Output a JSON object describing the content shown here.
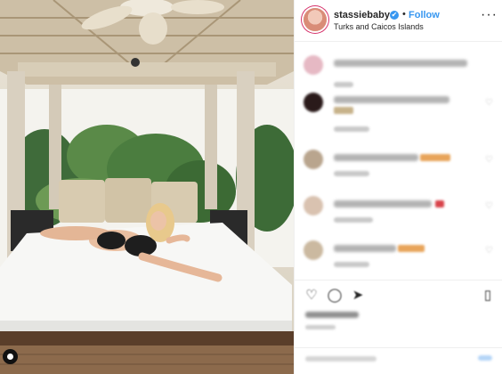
{
  "post": {
    "username": "stassiebaby",
    "location": "Turks and Caicos Islands",
    "follow_label": "Follow",
    "separator": "•",
    "verified_mark": "✔"
  },
  "icons": {
    "more": "more-options-icon",
    "like": "heart-icon",
    "comment": "comment-icon",
    "share": "share-icon",
    "save": "bookmark-icon"
  },
  "colors": {
    "accent": "#3897f0",
    "text": "#262626",
    "border": "#efefef"
  }
}
